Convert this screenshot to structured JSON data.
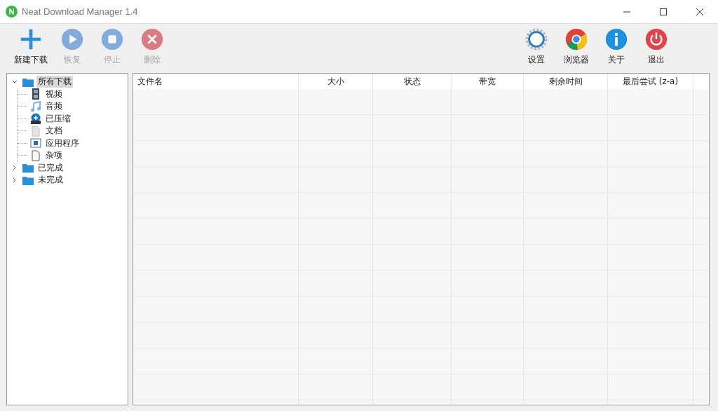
{
  "window": {
    "title": "Neat Download Manager 1.4"
  },
  "toolbar": {
    "left": [
      {
        "label": "新建下载",
        "kind": "add",
        "disabled": false
      },
      {
        "label": "恢复",
        "kind": "resume",
        "disabled": true
      },
      {
        "label": "停止",
        "kind": "stop",
        "disabled": true
      },
      {
        "label": "删除",
        "kind": "delete",
        "disabled": true
      }
    ],
    "right": [
      {
        "label": "设置",
        "kind": "settings",
        "disabled": false
      },
      {
        "label": "浏览器",
        "kind": "browser",
        "disabled": false
      },
      {
        "label": "关于",
        "kind": "about",
        "disabled": false
      },
      {
        "label": "退出",
        "kind": "exit",
        "disabled": false
      }
    ]
  },
  "tree": [
    {
      "label": "所有下载",
      "kind": "folder",
      "expanded": true,
      "selected": true,
      "children": [
        {
          "label": "视频",
          "kind": "video",
          "selected": false
        },
        {
          "label": "音频",
          "kind": "audio",
          "selected": false
        },
        {
          "label": "已压缩",
          "kind": "zip",
          "selected": false
        },
        {
          "label": "文档",
          "kind": "doc",
          "selected": false
        },
        {
          "label": "应用程序",
          "kind": "app",
          "selected": false
        },
        {
          "label": "杂项",
          "kind": "file",
          "selected": false
        }
      ]
    },
    {
      "label": "已完成",
      "kind": "folder",
      "expanded": false,
      "selected": false
    },
    {
      "label": "未完成",
      "kind": "folder",
      "expanded": false,
      "selected": false
    }
  ],
  "table": {
    "columns": [
      "文件名",
      "大小",
      "状态",
      "带宽",
      "剩余时间",
      "最后尝试 (z-a)"
    ]
  }
}
